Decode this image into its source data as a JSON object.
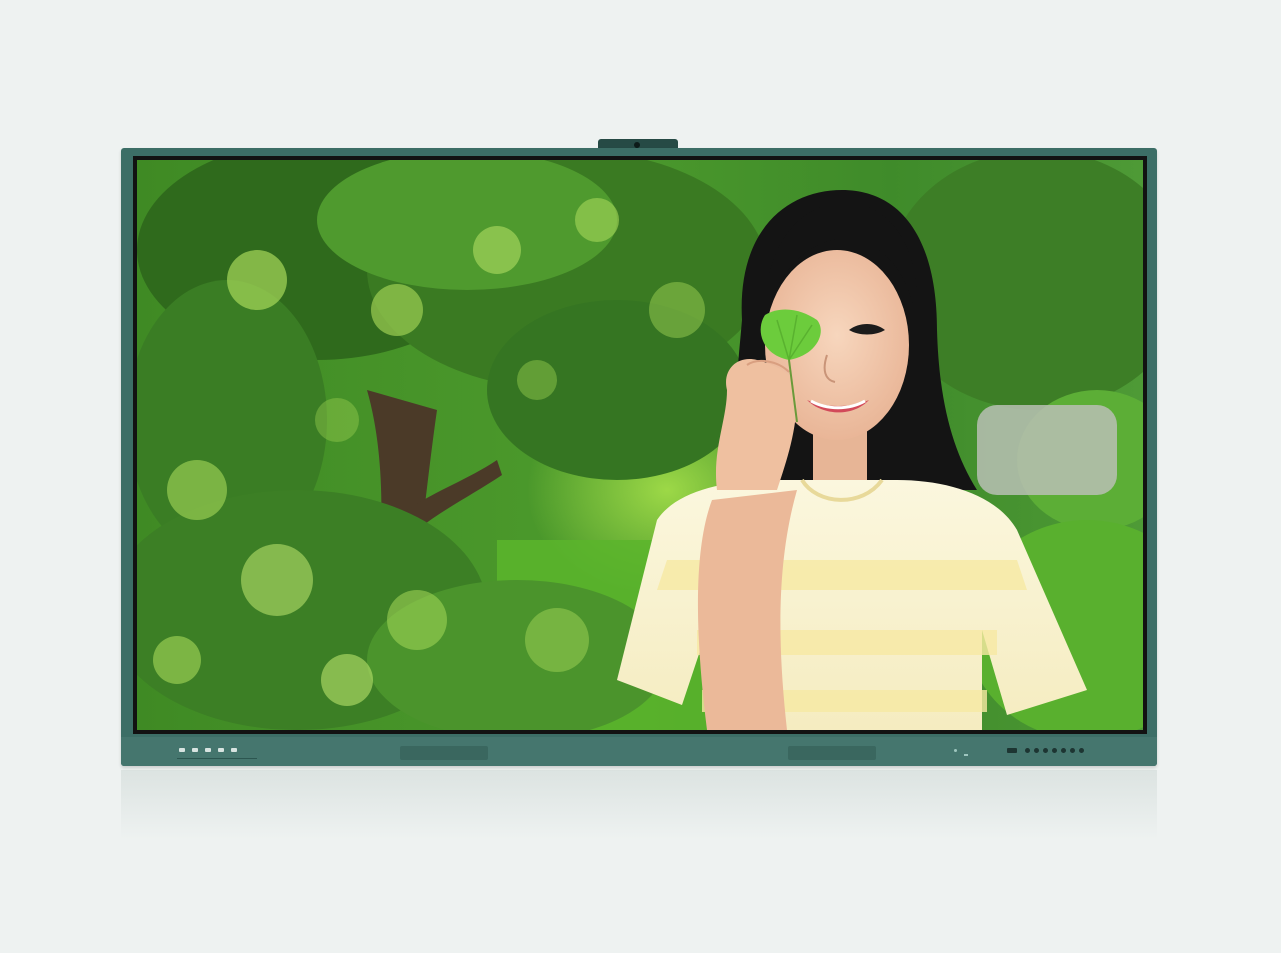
{
  "device": {
    "bezel_color": "#3c6e66",
    "chin_color": "#45766e",
    "background_color": "#eef2f1",
    "camera_present": true
  },
  "screen_content": {
    "scene": "outdoor-portrait-with-ginkgo-leaf",
    "palette": {
      "foliage_dark": "#2f6a1c",
      "foliage_mid": "#5aa532",
      "foliage_light": "#a6d85a",
      "grass": "#58b82a",
      "hair": "#141414",
      "skin": "#f2c8ac",
      "shirt": "#fbf6d8",
      "shirt_stripe": "#f6e9a2",
      "leaf": "#6ccc3c"
    }
  },
  "controls": {
    "front_buttons_count": 5,
    "ports_count": 8
  }
}
